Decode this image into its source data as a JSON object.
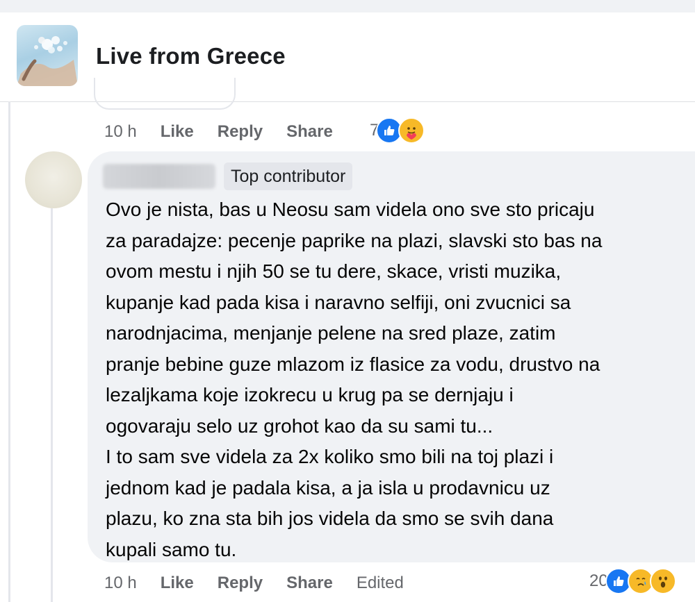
{
  "group": {
    "title": "Live from Greece",
    "avatar_icon": "group-photo-icon"
  },
  "previous_comment": {
    "time": "10 h",
    "like_label": "Like",
    "reply_label": "Reply",
    "share_label": "Share",
    "reaction_count": "7",
    "reactions": [
      "like-reaction-icon",
      "care-reaction-icon"
    ]
  },
  "comment": {
    "author_badge": "Top contributor",
    "text": "Ovo je nista, bas u Neosu sam videla ono sve sto pricaju\nza paradajze: pecenje paprike na plazi, slavski sto bas na\novom mestu i njih 50 se tu dere, skace, vristi muzika,\nkupanje kad pada kisa i naravno selfiji, oni zvucnici sa\nnarodnjacima, menjanje pelene na sred plaze, zatim\npranje bebine guze mlazom iz flasice za vodu, drustvo na\nlezaljkama koje izokrecu u krug pa se dernjaju i\nogovaraju selo uz grohot kao da su sami tu...\nI to sam sve videla za 2x koliko smo bili na toj plazi i\njednom kad je padala kisa, a ja isla u prodavnicu uz\nplazu, ko zna sta bih jos videla da smo se svih dana\nkupali samo tu.",
    "time": "10 h",
    "like_label": "Like",
    "reply_label": "Reply",
    "share_label": "Share",
    "edited_label": "Edited",
    "reaction_count": "20",
    "reactions": [
      "like-reaction-icon",
      "sad-reaction-icon",
      "wow-reaction-icon"
    ]
  },
  "colors": {
    "like_blue": "#1877f2",
    "reaction_yellow": "#f7b928",
    "bubble_bg": "#f0f2f5",
    "secondary_text": "#65676b"
  }
}
